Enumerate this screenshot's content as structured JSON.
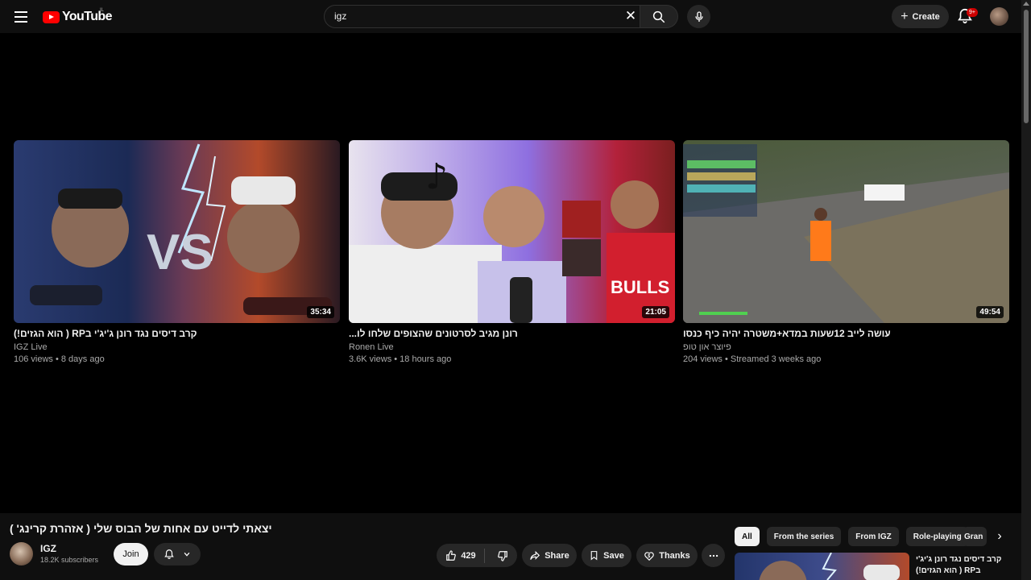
{
  "masthead": {
    "logo_text": "YouTube",
    "country": "IL",
    "search_value": "igz",
    "create_label": "Create",
    "notification_badge": "9+"
  },
  "videos": [
    {
      "title": "קרב דיסים נגד רונן ג'יג'י בRP ( הוא הגזים!)",
      "channel": "IGZ Live",
      "meta": "106 views • 8 days ago",
      "duration": "35:34"
    },
    {
      "title": "רונן מגיב לסרטונים שהצופים שלחו לו...",
      "channel": "Ronen Live",
      "meta": "3.6K views • 18 hours ago",
      "duration": "21:05"
    },
    {
      "title": "עושה לייב 12שעות במדא+משטרה יהיה כיף כנסו",
      "channel": "פיוצר און טופ",
      "meta": "204 views • Streamed 3 weeks ago",
      "duration": "49:54"
    }
  ],
  "watch": {
    "title": "יצאתי לדייט עם אחות של הבוס שלי ( אזהרת קרינג' )",
    "channel_name": "IGZ",
    "subscribers": "18.2K subscribers",
    "join_label": "Join",
    "likes": "429",
    "share_label": "Share",
    "save_label": "Save",
    "thanks_label": "Thanks"
  },
  "chips": [
    "All",
    "From the series",
    "From IGZ",
    "Role-playing"
  ],
  "chip_truncated": "Gran",
  "sidebar_next": {
    "title": "קרב דיסים נגד רונן ג'יג'י בRP ( הוא הגזים!)"
  },
  "colors": {
    "background": "#000000",
    "surface": "#0f0f0f",
    "pill": "#272727",
    "brand_red": "#ff0000",
    "badge_red": "#cc0000"
  }
}
